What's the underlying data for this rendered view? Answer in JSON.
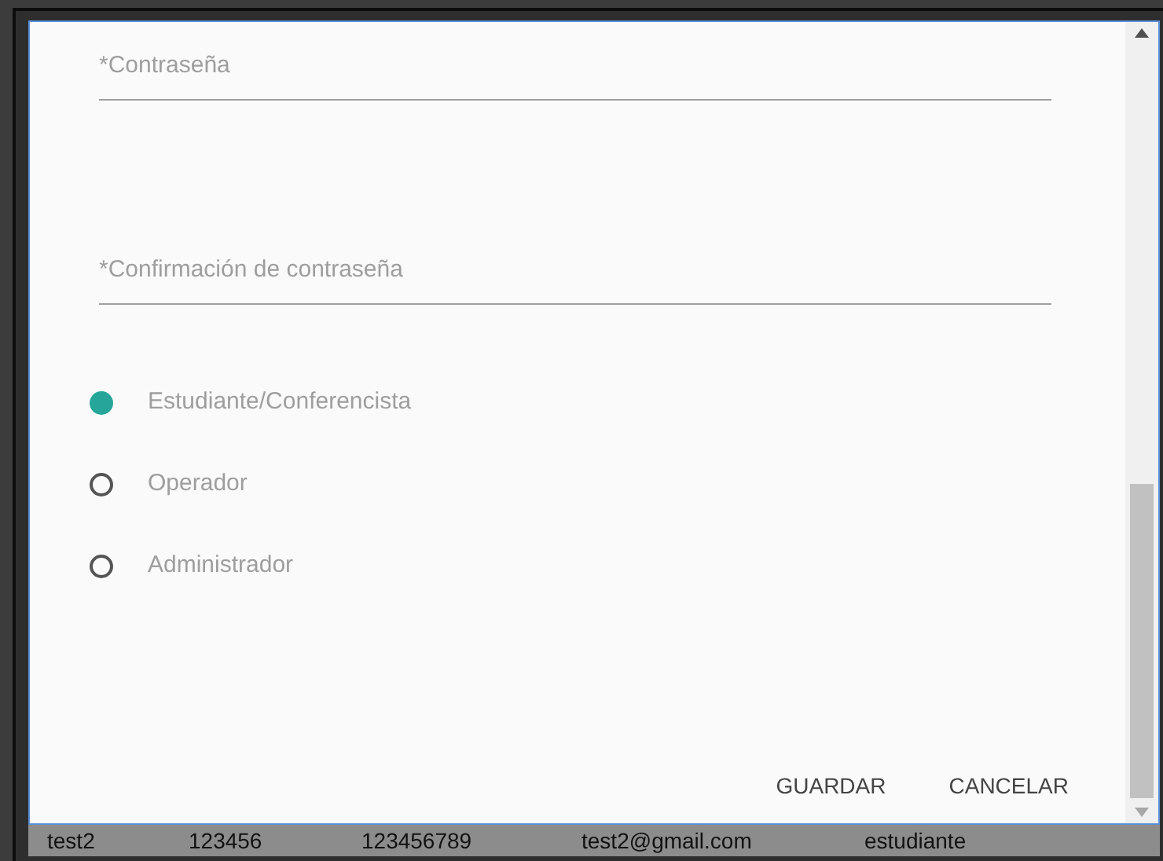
{
  "dialog": {
    "fields": [
      {
        "placeholder": "*Contraseña"
      },
      {
        "placeholder": "*Confirmación de contraseña"
      }
    ],
    "roles": [
      {
        "label": "Estudiante/Conferencista",
        "selected": true
      },
      {
        "label": "Operador",
        "selected": false
      },
      {
        "label": "Administrador",
        "selected": false
      }
    ],
    "buttons": [
      "GUARDAR",
      "CANCELAR"
    ]
  },
  "table_row": [
    "test2",
    "123456",
    "123456789",
    "test2@gmail.com",
    "estudiante"
  ]
}
